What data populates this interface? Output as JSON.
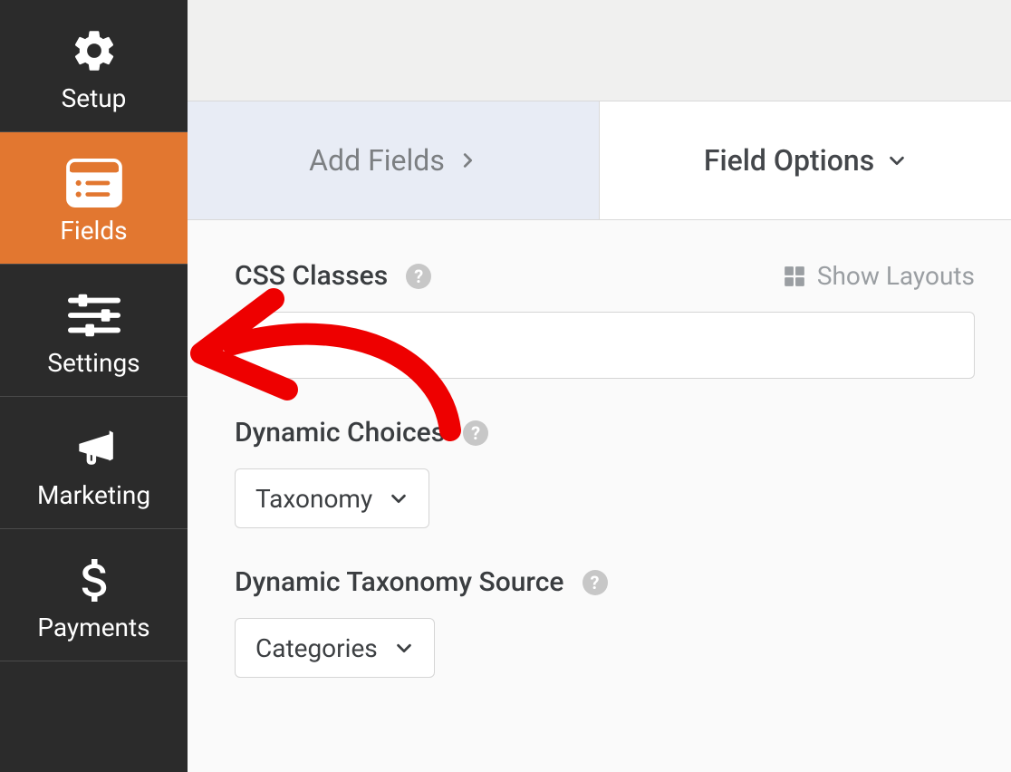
{
  "sidebar": {
    "items": [
      {
        "label": "Setup",
        "icon": "gear"
      },
      {
        "label": "Fields",
        "icon": "list-box",
        "active": true
      },
      {
        "label": "Settings",
        "icon": "sliders"
      },
      {
        "label": "Marketing",
        "icon": "megaphone"
      },
      {
        "label": "Payments",
        "icon": "dollar"
      }
    ]
  },
  "tabs": {
    "add_fields": "Add Fields",
    "field_options": "Field Options"
  },
  "fields": {
    "css_classes": {
      "label": "CSS Classes",
      "value": "",
      "show_layouts": "Show Layouts"
    },
    "dynamic_choices": {
      "label": "Dynamic Choices",
      "value": "Taxonomy"
    },
    "dynamic_taxonomy_source": {
      "label": "Dynamic Taxonomy Source",
      "value": "Categories"
    }
  }
}
